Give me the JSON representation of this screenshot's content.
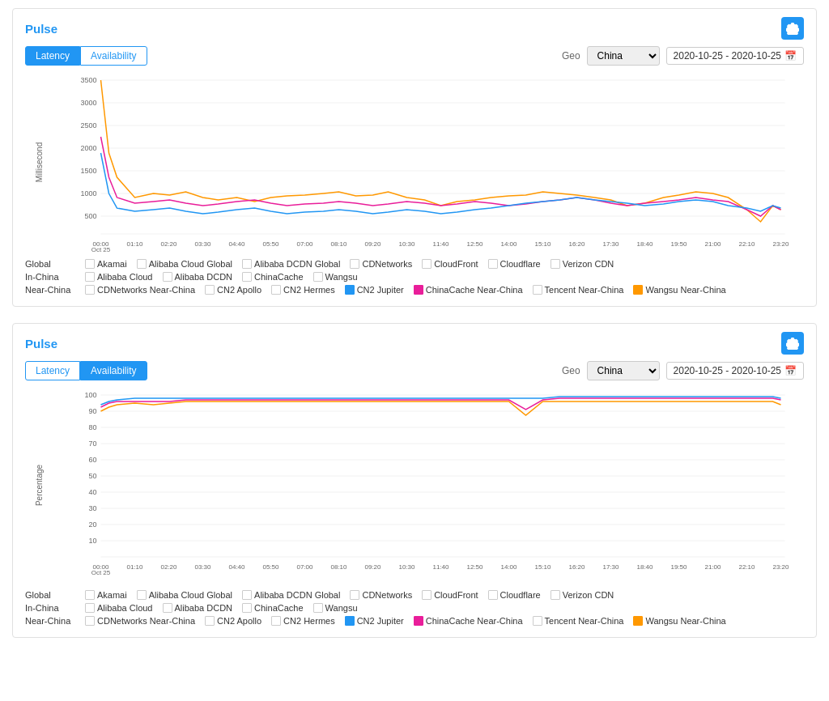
{
  "widgets": [
    {
      "id": "widget1",
      "title": "Pulse",
      "activeTab": "latency",
      "tabs": [
        {
          "id": "latency",
          "label": "Latency"
        },
        {
          "id": "availability",
          "label": "Availability"
        }
      ],
      "geo_label": "Geo",
      "geo_value": "China",
      "date_range": "2020-10-25 - 2020-10-25",
      "y_axis_label": "Millisecond",
      "x_ticks": [
        "00:00\nOct 25",
        "01:10",
        "02:20",
        "03:30",
        "04:40",
        "05:50",
        "07:00",
        "08:10",
        "09:20",
        "10:30",
        "11:40",
        "12:50",
        "14:00",
        "15:10",
        "16:20",
        "17:30",
        "18:40",
        "19:50",
        "21:00",
        "22:10",
        "23:20"
      ],
      "y_ticks": [
        "3500",
        "3000",
        "2500",
        "2000",
        "1500",
        "1000",
        "500",
        ""
      ],
      "legend_rows": [
        {
          "category": "Global",
          "items": [
            "Akamai",
            "Alibaba Cloud Global",
            "Alibaba DCDN Global",
            "CDNetworks",
            "CloudFront",
            "Cloudflare",
            "Verizon CDN"
          ]
        },
        {
          "category": "In-China",
          "items": [
            "Alibaba Cloud",
            "Alibaba DCDN",
            "ChinaCache",
            "Wangsu"
          ]
        },
        {
          "category": "Near-China",
          "items_special": [
            {
              "label": "CDNetworks Near-China",
              "filled": false
            },
            {
              "label": "CN2 Apollo",
              "filled": false
            },
            {
              "label": "CN2 Hermes",
              "filled": false
            },
            {
              "label": "CN2 Jupiter",
              "filled": true,
              "color": "blue"
            },
            {
              "label": "ChinaCache Near-China",
              "filled": true,
              "color": "pink"
            },
            {
              "label": "Tencent Near-China",
              "filled": false
            },
            {
              "label": "Wangsu Near-China",
              "filled": true,
              "color": "orange"
            }
          ]
        }
      ]
    },
    {
      "id": "widget2",
      "title": "Pulse",
      "activeTab": "availability",
      "tabs": [
        {
          "id": "latency",
          "label": "Latency"
        },
        {
          "id": "availability",
          "label": "Availability"
        }
      ],
      "geo_label": "Geo",
      "geo_value": "China",
      "date_range": "2020-10-25 - 2020-10-25",
      "y_axis_label": "Percentage",
      "x_ticks": [
        "00:00\nOct 25",
        "01:10",
        "02:20",
        "03:30",
        "04:40",
        "05:50",
        "07:00",
        "08:10",
        "09:20",
        "10:30",
        "11:40",
        "12:50",
        "14:00",
        "15:10",
        "16:20",
        "17:30",
        "18:40",
        "19:50",
        "21:00",
        "22:10",
        "23:20"
      ],
      "y_ticks": [
        "100",
        "90",
        "80",
        "70",
        "60",
        "50",
        "40",
        "30",
        "20",
        "10",
        ""
      ],
      "legend_rows": [
        {
          "category": "Global",
          "items": [
            "Akamai",
            "Alibaba Cloud Global",
            "Alibaba DCDN Global",
            "CDNetworks",
            "CloudFront",
            "Cloudflare",
            "Verizon CDN"
          ]
        },
        {
          "category": "In-China",
          "items": [
            "Alibaba Cloud",
            "Alibaba DCDN",
            "ChinaCache",
            "Wangsu"
          ]
        },
        {
          "category": "Near-China",
          "items_special": [
            {
              "label": "CDNetworks Near-China",
              "filled": false
            },
            {
              "label": "CN2 Apollo",
              "filled": false
            },
            {
              "label": "CN2 Hermes",
              "filled": false
            },
            {
              "label": "CN2 Jupiter",
              "filled": true,
              "color": "blue"
            },
            {
              "label": "ChinaCache Near-China",
              "filled": true,
              "color": "pink"
            },
            {
              "label": "Tencent Near-China",
              "filled": false
            },
            {
              "label": "Wangsu Near-China",
              "filled": true,
              "color": "orange"
            }
          ]
        }
      ]
    }
  ],
  "icons": {
    "gear": "⚙",
    "calendar": "📅"
  }
}
